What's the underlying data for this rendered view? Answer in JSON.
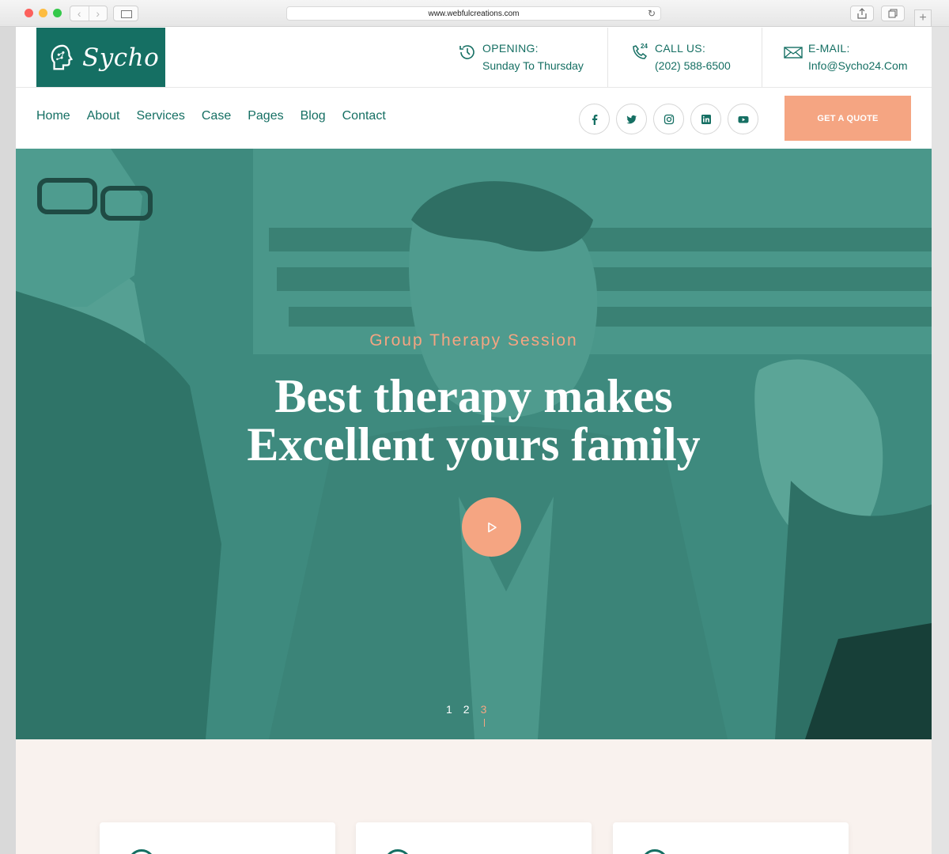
{
  "browser": {
    "url": "www.webfulcreations.com"
  },
  "brand": {
    "name": "Sycho",
    "color": "#156f63",
    "accent": "#f5a582"
  },
  "header": {
    "opening_label": "OPENING:",
    "opening_value": "Sunday To Thursday",
    "call_label": "CALL US:",
    "call_value": "(202) 588-6500",
    "call_icon_badge": "24",
    "email_label": "E-MAIL:",
    "email_value": "Info@Sycho24.Com"
  },
  "nav": {
    "items": [
      "Home",
      "About",
      "Services",
      "Case",
      "Pages",
      "Blog",
      "Contact"
    ]
  },
  "socials": [
    "facebook-icon",
    "twitter-icon",
    "instagram-icon",
    "linkedin-icon",
    "youtube-icon"
  ],
  "cta": {
    "label": "GET A QUOTE"
  },
  "hero": {
    "subtitle": "Group Therapy Session",
    "title_line1": "Best therapy makes",
    "title_line2": "Excellent yours family",
    "slides": [
      "1",
      "2",
      "3"
    ],
    "active_slide": "3"
  }
}
